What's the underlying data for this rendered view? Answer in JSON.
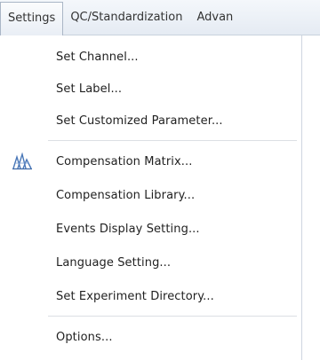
{
  "menubar": {
    "items": [
      {
        "label": "Settings",
        "active": true
      },
      {
        "label": "QC/Standardization",
        "active": false
      },
      {
        "label": "Advan",
        "active": false
      }
    ]
  },
  "settings_menu": {
    "items": [
      {
        "label": "Set Channel..."
      },
      {
        "label": "Set Label..."
      },
      {
        "label": "Set Customized Parameter..."
      },
      {
        "label": "Compensation Matrix...",
        "icon": "compensation-matrix-icon"
      },
      {
        "label": "Compensation Library..."
      },
      {
        "label": "Events Display Setting..."
      },
      {
        "label": "Language Setting..."
      },
      {
        "label": "Set Experiment Directory..."
      },
      {
        "label": "Options..."
      }
    ]
  },
  "colors": {
    "menubar_bg": "#e5ebf3",
    "icon_blue": "#4a78b8"
  }
}
